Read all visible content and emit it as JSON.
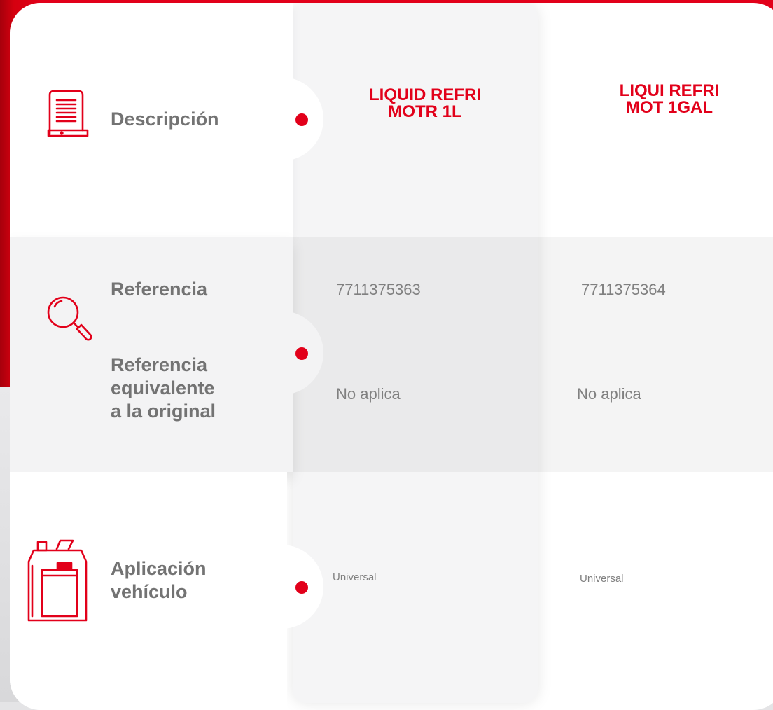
{
  "rows": {
    "descripcion": {
      "label": "Descripción",
      "icon": "document-icon"
    },
    "referencia": {
      "label": "Referencia",
      "icon": "magnifier-icon"
    },
    "referencia_equivalente": {
      "label_lines": [
        "Referencia",
        "equivalente",
        "a la original"
      ]
    },
    "aplicacion": {
      "label_lines": [
        "Aplicación",
        "vehículo"
      ],
      "icon": "jerrycan-icon"
    }
  },
  "products": [
    {
      "title_lines": [
        "LIQUID REFRI",
        "MOTR 1L"
      ],
      "referencia": "7711375363",
      "referencia_equivalente": "No aplica",
      "aplicacion": "Universal"
    },
    {
      "title_lines": [
        "LIQUI REFRI",
        "MOT 1GAL"
      ],
      "referencia": "7711375364",
      "referencia_equivalente": "No aplica",
      "aplicacion": "Universal"
    }
  ],
  "colors": {
    "accent": "#e2001a",
    "label_text": "#737373",
    "value_text": "#808080"
  }
}
